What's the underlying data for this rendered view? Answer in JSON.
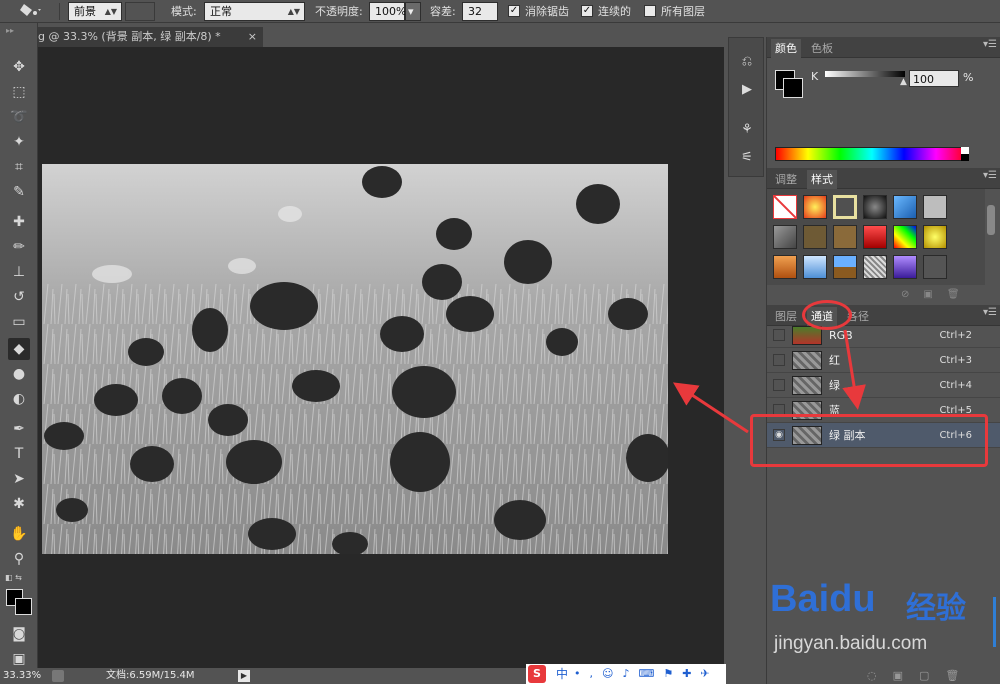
{
  "options_bar": {
    "tool_preset": "前景",
    "mode_label": "模式:",
    "mode_value": "正常",
    "opacity_label": "不透明度:",
    "opacity_value": "100%",
    "tolerance_label": "容差:",
    "tolerance_value": "32",
    "antialias_label": "消除锯齿",
    "antialias_checked": true,
    "contiguous_label": "连续的",
    "contiguous_checked": true,
    "all_layers_label": "所有图层",
    "all_layers_checked": false
  },
  "document": {
    "tab_title": "g @ 33.3% (背景 副本, 绿 副本/8) *",
    "close": "×"
  },
  "status_bar": {
    "zoom": "33.33%",
    "doc_info": "文档:6.59M/15.4M"
  },
  "color_panel": {
    "tabs": [
      "颜色",
      "色板"
    ],
    "channel_label": "K",
    "value": "100",
    "unit": "%"
  },
  "styles_panel": {
    "tabs": [
      "调整",
      "样式"
    ]
  },
  "channels_panel": {
    "tabs": [
      "图层",
      "通道",
      "路径"
    ],
    "visible_tab_labels": [
      "图层",
      "通道",
      "各径"
    ],
    "rows": [
      {
        "name": "RGB",
        "shortcut": "Ctrl+2",
        "visible": false,
        "selected": false
      },
      {
        "name": "红",
        "shortcut": "Ctrl+3",
        "visible": false,
        "selected": false
      },
      {
        "name": "绿",
        "shortcut": "Ctrl+4",
        "visible": false,
        "selected": false
      },
      {
        "name": "蓝",
        "shortcut": "Ctrl+5",
        "visible": false,
        "selected": false
      },
      {
        "name": "绿 副本",
        "shortcut": "Ctrl+6",
        "visible": true,
        "selected": true
      }
    ]
  },
  "watermark": {
    "brand": "Baidu",
    "brand_cn": "经验",
    "url": "jingyan.baidu.com"
  },
  "ime_bar": {
    "label": "中"
  },
  "colors": {
    "annotation_red": "#e8393c",
    "panel_bg": "#535353",
    "canvas_bg": "#282828",
    "selected_row": "#4f5a6b",
    "watermark_blue": "#2f6fd6"
  }
}
